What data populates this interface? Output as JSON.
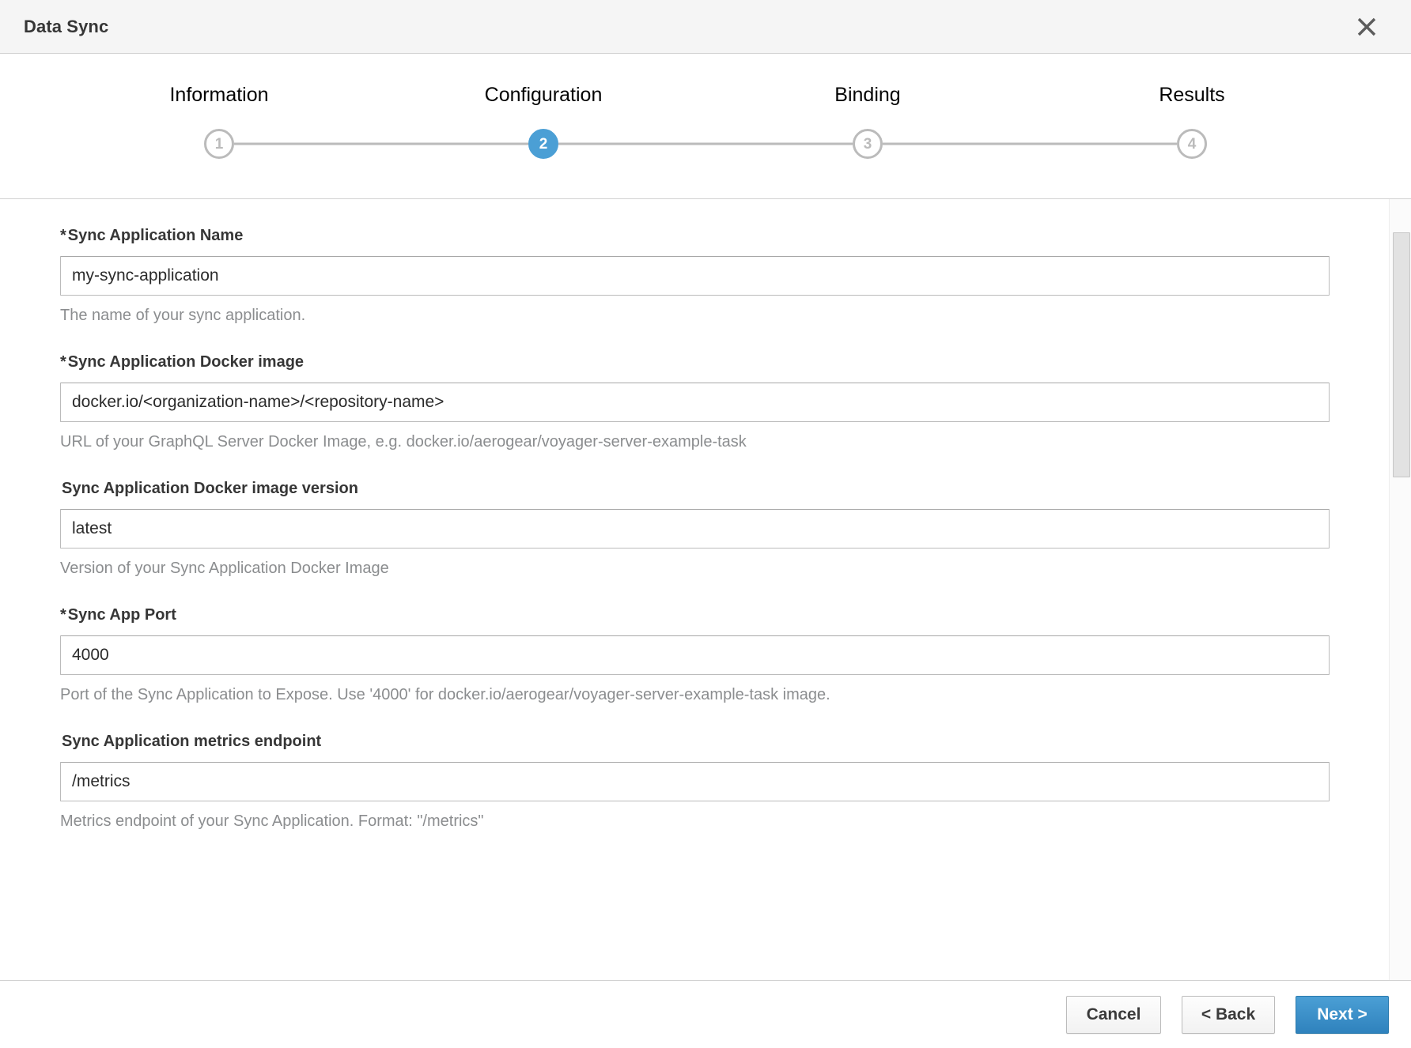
{
  "header": {
    "title": "Data Sync",
    "close_icon": "close-icon"
  },
  "wizard": {
    "steps": [
      {
        "label": "Information",
        "number": "1",
        "active": false
      },
      {
        "label": "Configuration",
        "number": "2",
        "active": true
      },
      {
        "label": "Binding",
        "number": "3",
        "active": false
      },
      {
        "label": "Results",
        "number": "4",
        "active": false
      }
    ],
    "active_step_color": "#4b9fd5",
    "inactive_step_color": "#bbbbbb"
  },
  "form": {
    "fields": [
      {
        "label": "Sync Application Name",
        "required": true,
        "star": "*",
        "value": "my-sync-application",
        "help": "The name of your sync application."
      },
      {
        "label": "Sync Application Docker image",
        "required": true,
        "star": "*",
        "value": "docker.io/<organization-name>/<repository-name>",
        "help": "URL of your GraphQL Server Docker Image, e.g. docker.io/aerogear/voyager-server-example-task"
      },
      {
        "label": "Sync Application Docker image version",
        "required": false,
        "star": "",
        "value": "latest",
        "help": "Version of your Sync Application Docker Image"
      },
      {
        "label": "Sync App Port",
        "required": true,
        "star": "*",
        "value": "4000",
        "help": "Port of the Sync Application to Expose. Use '4000' for docker.io/aerogear/voyager-server-example-task image."
      },
      {
        "label": "Sync Application metrics endpoint",
        "required": false,
        "star": "",
        "value": "/metrics",
        "help": "Metrics endpoint of your Sync Application. Format: \"/metrics\""
      }
    ]
  },
  "footer": {
    "cancel_label": "Cancel",
    "back_label": "< Back",
    "next_label": "Next >",
    "primary_color": "#2f82bd"
  }
}
